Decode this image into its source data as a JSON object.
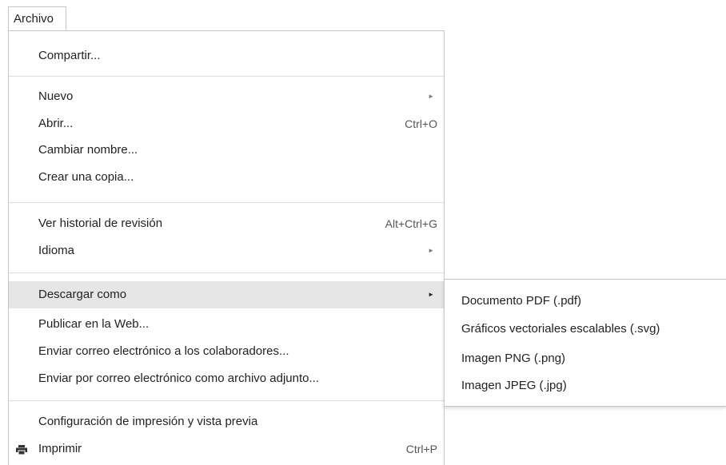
{
  "menubar": {
    "file_label": "Archivo"
  },
  "menu": {
    "share": "Compartir...",
    "new": "Nuevo",
    "open": "Abrir...",
    "open_shortcut": "Ctrl+O",
    "rename": "Cambiar nombre...",
    "make_copy": "Crear una copia...",
    "revision_history": "Ver historial de revisión",
    "revision_history_shortcut": "Alt+Ctrl+G",
    "language": "Idioma",
    "download_as": "Descargar como",
    "publish_web": "Publicar en la Web...",
    "email_collaborators": "Enviar correo electrónico a los colaboradores...",
    "email_attachment": "Enviar por correo electrónico como archivo adjunto...",
    "print_settings": "Configuración de impresión y vista previa",
    "print": "Imprimir",
    "print_shortcut": "Ctrl+P",
    "submenu_arrow": "►"
  },
  "submenu": {
    "pdf": "Documento PDF (.pdf)",
    "svg": "Gráficos vectoriales escalables (.svg)",
    "png": "Imagen PNG (.png)",
    "jpeg": "Imagen JPEG (.jpg)"
  }
}
